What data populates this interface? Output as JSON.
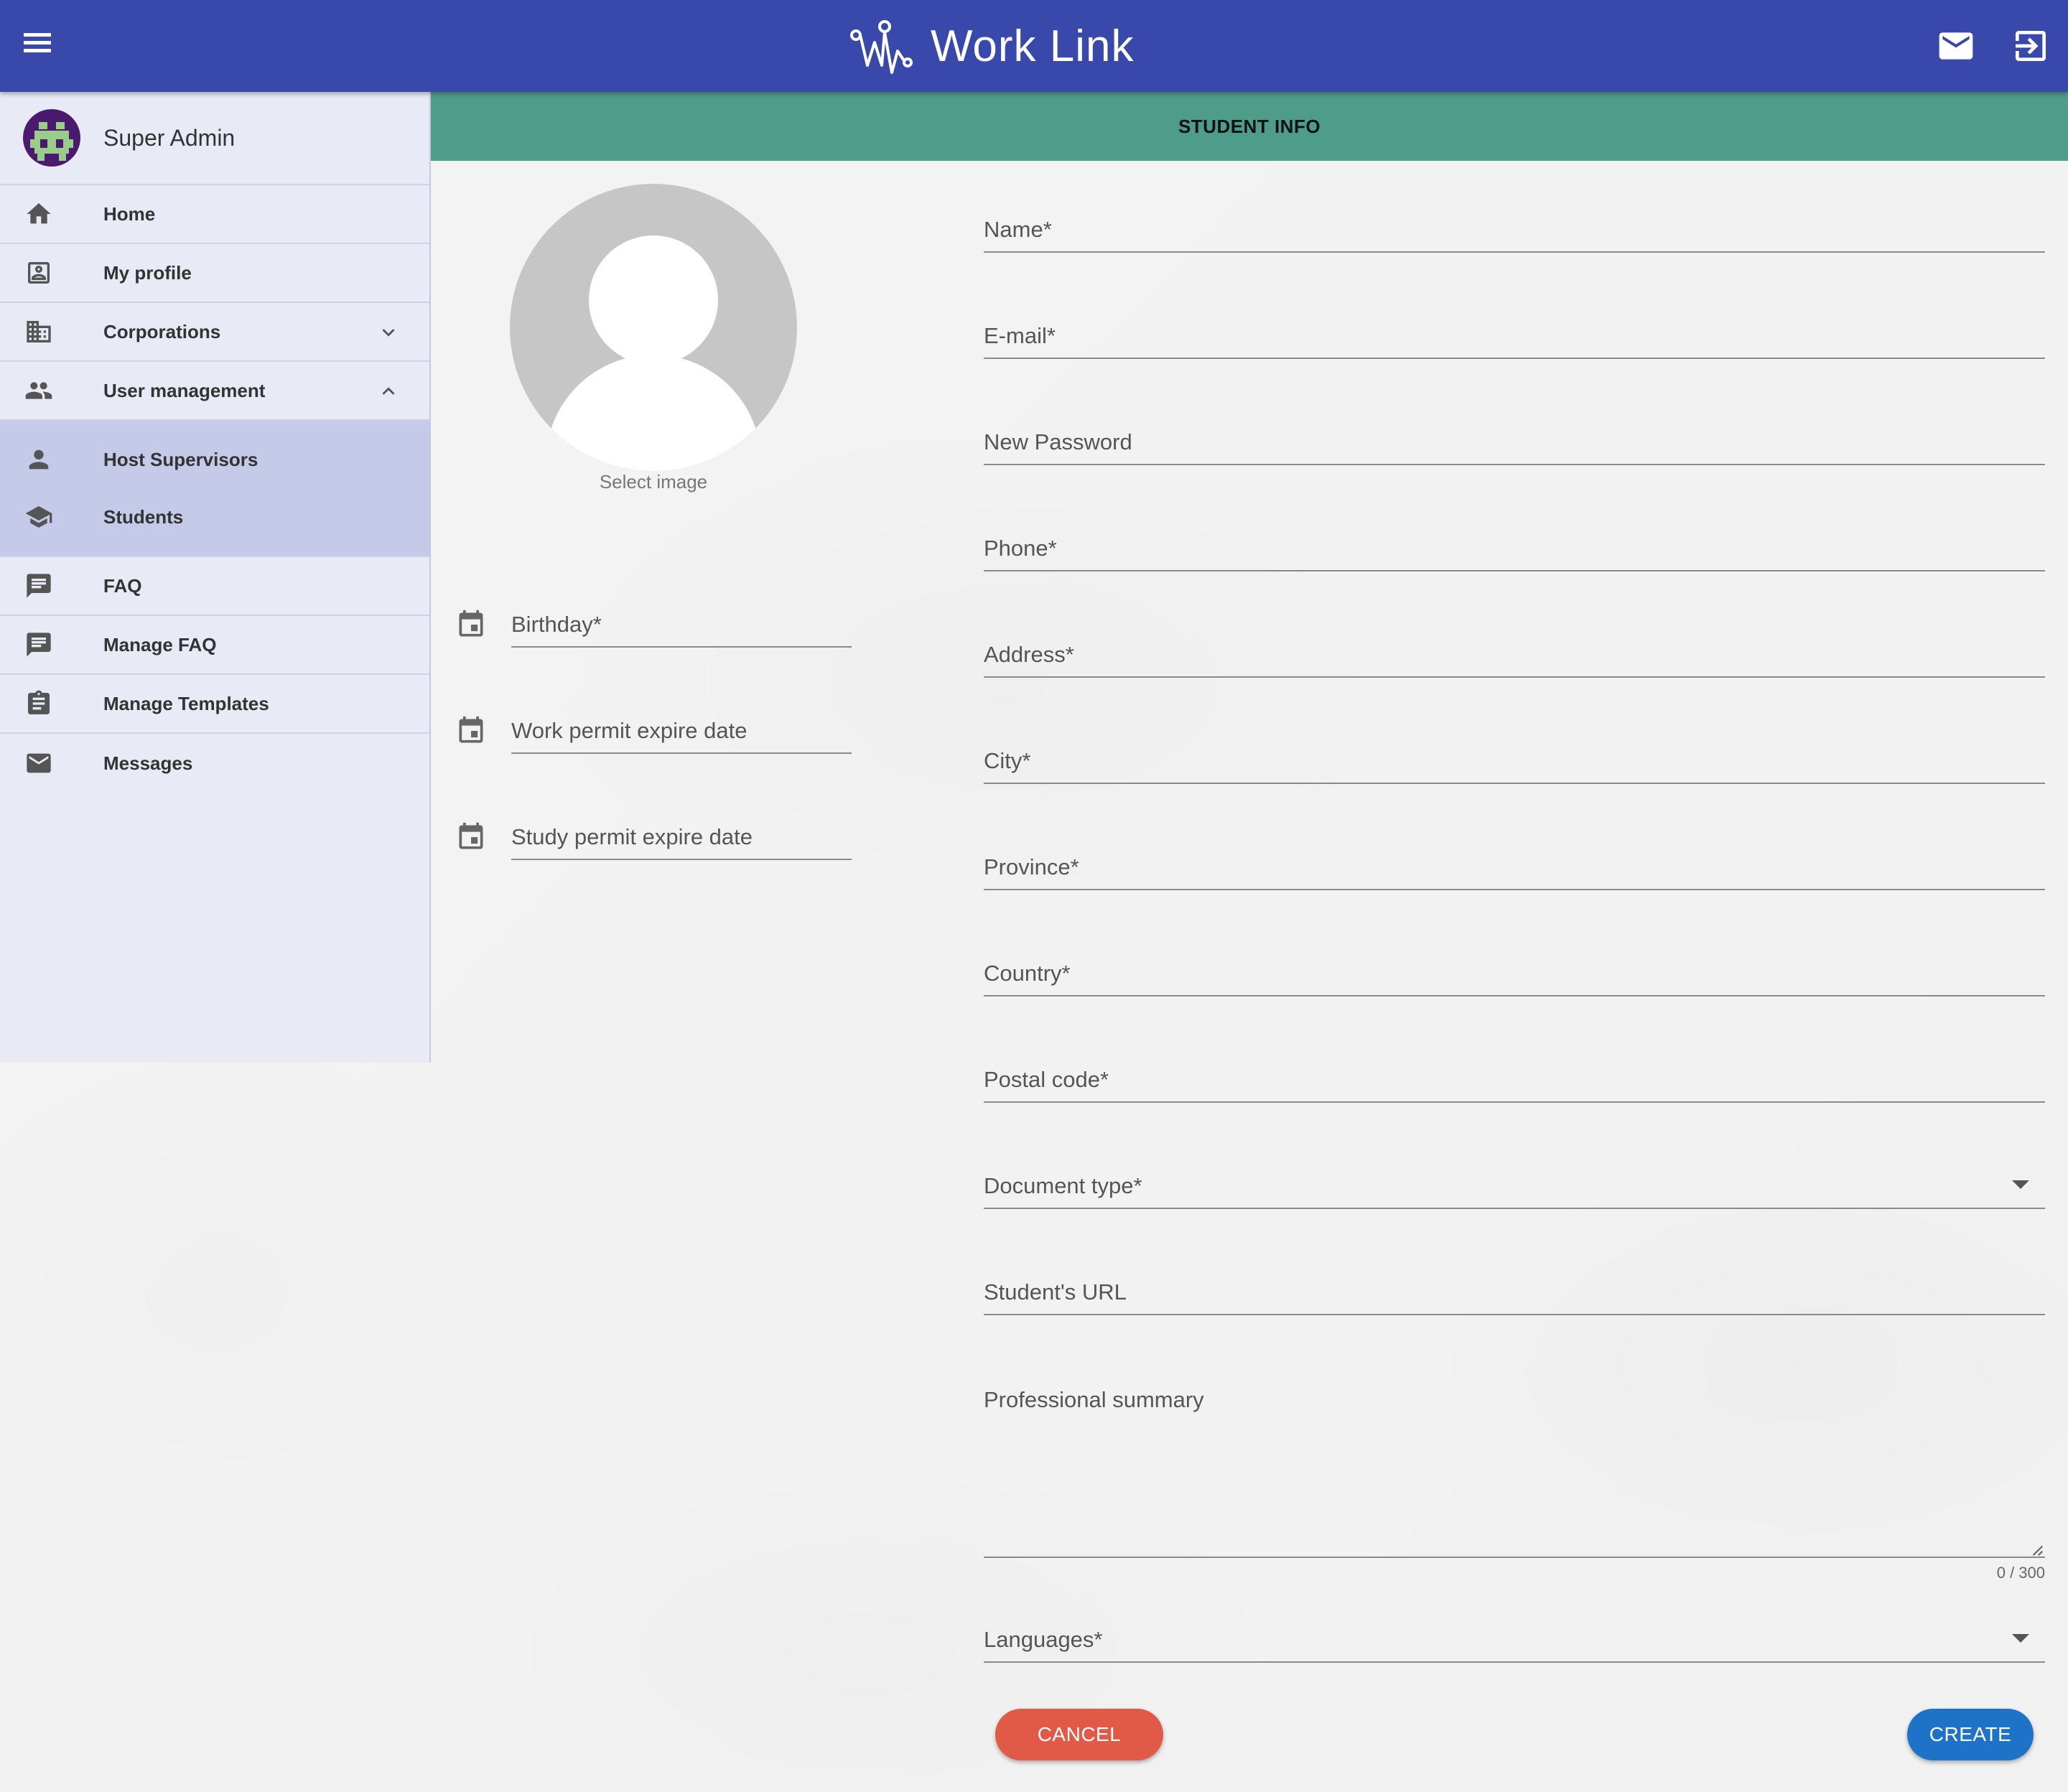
{
  "app": {
    "title": "Work Link"
  },
  "topbar": {
    "menu_icon": "hamburger-menu-icon",
    "mail_icon": "mail-icon",
    "logout_icon": "logout-icon"
  },
  "sidebar": {
    "user": {
      "name": "Super Admin"
    },
    "items": [
      {
        "label": "Home",
        "icon": "home-icon"
      },
      {
        "label": "My profile",
        "icon": "profile-icon"
      },
      {
        "label": "Corporations",
        "icon": "building-icon",
        "expanded": false
      },
      {
        "label": "User management",
        "icon": "group-icon",
        "expanded": true
      },
      {
        "label": "FAQ",
        "icon": "chat-icon"
      },
      {
        "label": "Manage FAQ",
        "icon": "chat-icon"
      },
      {
        "label": "Manage Templates",
        "icon": "clipboard-icon"
      },
      {
        "label": "Messages",
        "icon": "mail-icon"
      }
    ],
    "subitems": [
      {
        "label": "Host Supervisors",
        "icon": "person-icon"
      },
      {
        "label": "Students",
        "icon": "school-icon"
      }
    ]
  },
  "section": {
    "title": "STUDENT INFO"
  },
  "avatar": {
    "select_label": "Select image"
  },
  "date_fields": {
    "birthday": "Birthday*",
    "work_permit": "Work permit expire date",
    "study_permit": "Study permit expire date"
  },
  "fields": {
    "name": "Name*",
    "email": "E-mail*",
    "password": "New Password",
    "phone": "Phone*",
    "address": "Address*",
    "city": "City*",
    "province": "Province*",
    "country": "Country*",
    "postal": "Postal code*",
    "document_type": "Document type*",
    "student_url": "Student's URL",
    "summary": "Professional summary",
    "summary_counter": "0 / 300",
    "languages": "Languages*"
  },
  "buttons": {
    "cancel": "CANCEL",
    "create": "CREATE"
  },
  "colors": {
    "topbar": "#3949ab",
    "sidebar": "#e8eaf6",
    "submenu": "#c5cae9",
    "header": "#4e9c8a",
    "cancel": "#e05a47",
    "create": "#1e73c8"
  }
}
